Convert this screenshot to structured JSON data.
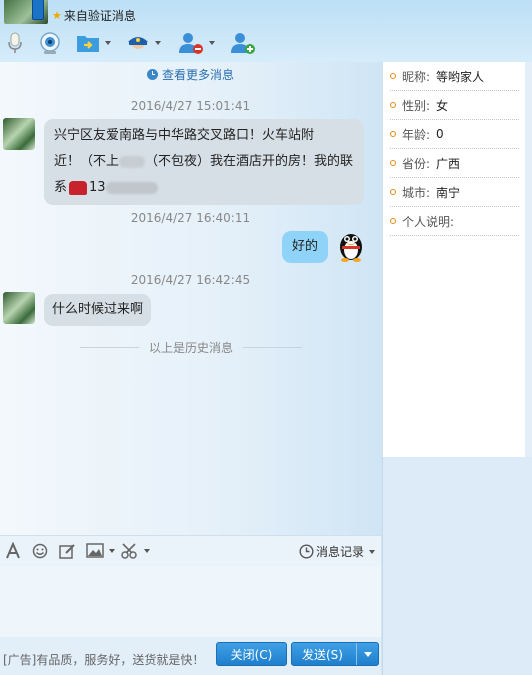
{
  "header": {
    "verify_text": "来自验证消息"
  },
  "toolbar": {
    "icons": [
      "microphone-icon",
      "webcam-icon",
      "file-transfer-icon",
      "police-icon",
      "remove-contact-icon",
      "add-contact-icon"
    ]
  },
  "chat": {
    "more_messages": "查看更多消息",
    "messages": [
      {
        "time": "2016/4/27 15:01:41",
        "line1": "兴宁区友爱南路与中华路交叉路口！火车站附",
        "line2a": "近！（不上",
        "line2b": "（不包夜）我在酒店开的房！我的联",
        "line3a": "系",
        "line3b": "13"
      },
      {
        "time": "2016/4/27 16:40:11",
        "text": "好的"
      },
      {
        "time": "2016/4/27 16:42:45",
        "text": "什么时候过来啊"
      }
    ],
    "history_label": "以上是历史消息"
  },
  "input_toolbar": {
    "history_label": "消息记录"
  },
  "bottom": {
    "ad": "[广告]有品质，服务好，送货就是快！",
    "close_label": "关闭(C)",
    "send_label": "发送(S)"
  },
  "profile": {
    "fields": [
      {
        "k": "昵称:",
        "v": "等哟家人"
      },
      {
        "k": "性别:",
        "v": "女"
      },
      {
        "k": "年龄:",
        "v": "0"
      },
      {
        "k": "省份:",
        "v": "广西"
      },
      {
        "k": "城市:",
        "v": "南宁"
      },
      {
        "k": "个人说明:",
        "v": ""
      }
    ]
  },
  "colors": {
    "accent": "#1f7fcc",
    "outgoing_bubble": "#8fd4f8",
    "incoming_bubble": "#d7dfe6"
  }
}
